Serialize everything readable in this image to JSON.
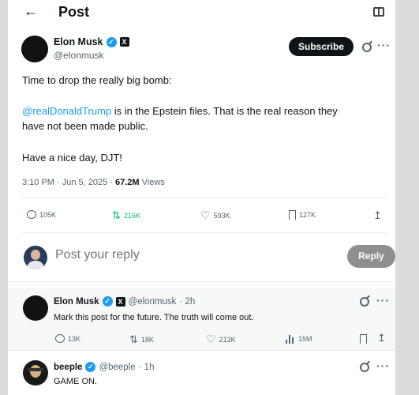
{
  "header": {
    "back_icon": "arrow-left-icon",
    "title": "Post",
    "reader_icon": "reader-mode-icon"
  },
  "post": {
    "author": {
      "name": "Elon Musk",
      "handle": "@elonmusk",
      "verified": true,
      "affiliate_badge": "X"
    },
    "subscribe_label": "Subscribe",
    "text": {
      "line1": "Time to drop the really big bomb:",
      "mention": "@realDonaldTrump",
      "line2_rest": " is in the Epstein files. That is the real reason they",
      "line3": "have not been made public.",
      "line4": "Have a nice day, DJT!"
    },
    "meta": {
      "time_date": "3:10 PM · Jun 5, 2025 · ",
      "views_count": "67.2M",
      "views_label": " Views"
    },
    "actions": {
      "replies": "105K",
      "reposts": "216K",
      "likes": "593K",
      "bookmarks": "127K"
    }
  },
  "reply_box": {
    "placeholder": "Post your reply",
    "button_label": "Reply"
  },
  "replies": [
    {
      "name": "Elon Musk",
      "badge": "X",
      "handle": "@elonmusk",
      "time": "· 2h",
      "text": "Mark this post for the future. The truth will come out.",
      "actions": {
        "replies": "13K",
        "reposts": "18K",
        "likes": "213K",
        "views": "15M"
      }
    },
    {
      "name": "beeple",
      "handle": "@beeple",
      "time": "· 1h",
      "text": "GAME ON."
    }
  ],
  "colors": {
    "accent": "#1d9bf0",
    "repost_green": "#00ba7c",
    "text": "#0f1419",
    "muted": "#536471"
  }
}
